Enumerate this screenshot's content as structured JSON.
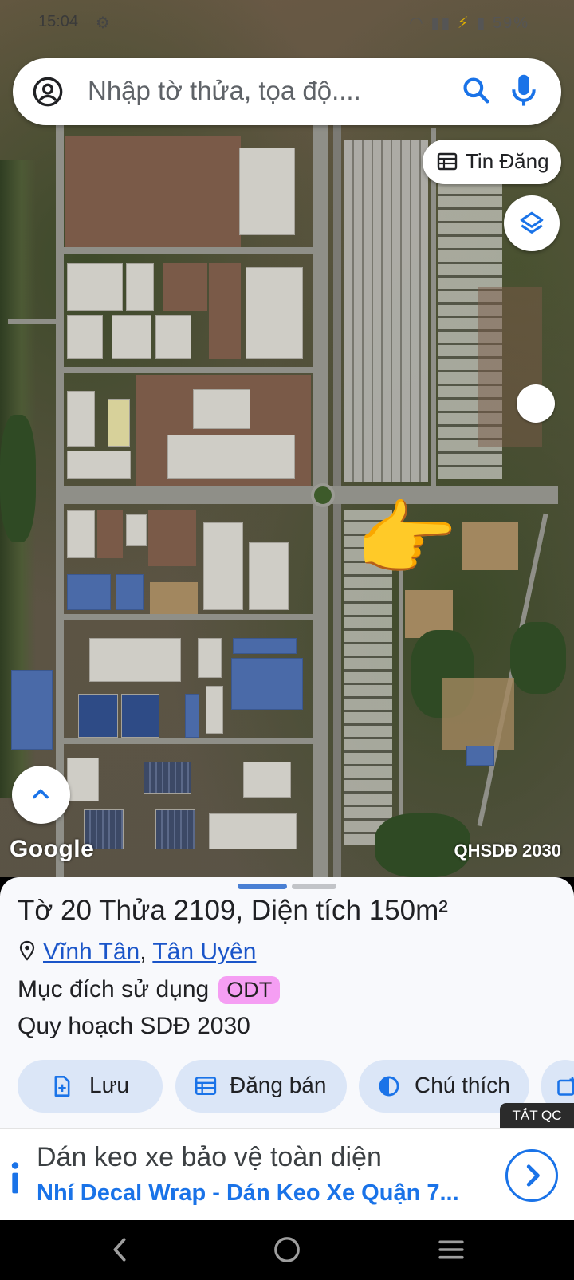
{
  "status_bar": {
    "time": "15:04",
    "battery": "59%"
  },
  "search": {
    "placeholder": "Nhập tờ thửa, tọa độ...."
  },
  "map": {
    "listings_button": "Tin Đăng",
    "attribution": "Google",
    "overlay_label": "QHSDĐ 2030",
    "pointer_emoji": "👉"
  },
  "parcel": {
    "title": "Tờ 20 Thửa 2109, Diện tích 150m²",
    "commune": "Vĩnh Tân",
    "separator": ",",
    "district": "Tân Uyên",
    "purpose_label": "Mục đích sử dụng",
    "purpose_code": "ODT",
    "plan_label": "Quy hoạch SDĐ 2030"
  },
  "actions": {
    "save": "Lưu",
    "post_sale": "Đăng bán",
    "legend": "Chú thích"
  },
  "ad": {
    "hide_label": "TẮT QC",
    "headline": "Dán keo xe bảo vệ toàn diện",
    "subline": "Nhí Decal Wrap - Dán Keo Xe Quận 7..."
  },
  "colors": {
    "accent": "#1a73e8",
    "chip_bg": "#dbe6f7",
    "badge_odt": "#f59ef3",
    "link": "#1a55c9"
  }
}
